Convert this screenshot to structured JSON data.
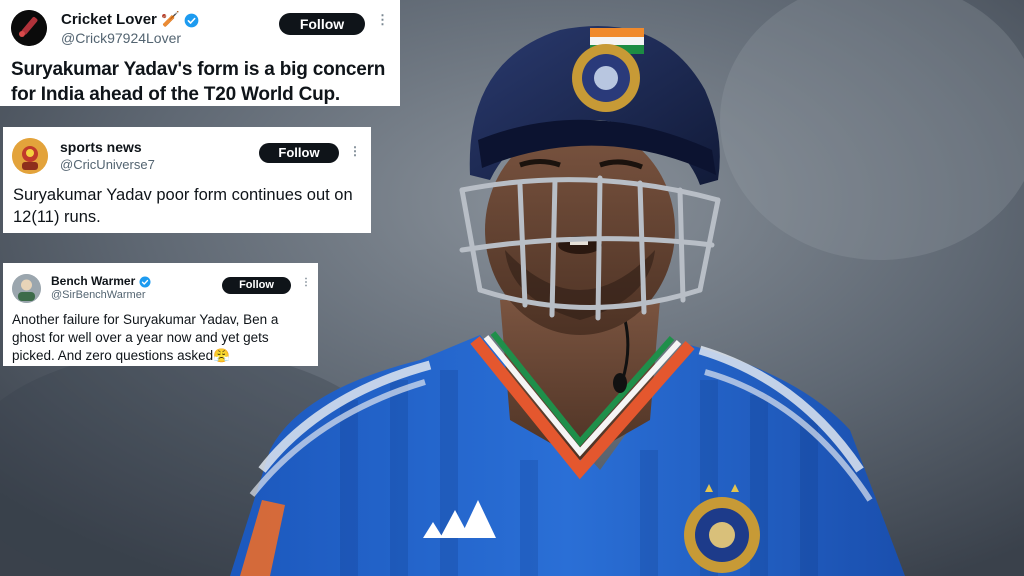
{
  "tweets": [
    {
      "name": "Cricket Lover",
      "name_emoji": "🏏",
      "handle": "@Crick97924Lover",
      "follow_label": "Follow",
      "text": "Suryakumar Yadav's form is a big concern for India ahead of the T20 World Cup.",
      "verified": true
    },
    {
      "name": "sports news",
      "handle": "@CricUniverse7",
      "follow_label": "Follow",
      "text": "Suryakumar Yadav poor form continues out on 12(11) runs.",
      "verified": false
    },
    {
      "name": "Bench Warmer",
      "handle": "@SirBenchWarmer",
      "follow_label": "Follow",
      "text": "Another failure for Suryakumar Yadav, Ben a ghost for well over a year now and yet gets picked. And zero questions asked😤",
      "verified": true
    }
  ],
  "colors": {
    "verified": "#1d9bf0",
    "jersey_blue": "#1f5fc4",
    "helmet_navy": "#1b2650",
    "follow_button": "#0f1419",
    "arrow_red": "#d32525"
  },
  "icons": [
    "cricket-bat-icon",
    "verified-badge-icon",
    "more-options-icon",
    "adidas-logo",
    "bcci-crest"
  ]
}
